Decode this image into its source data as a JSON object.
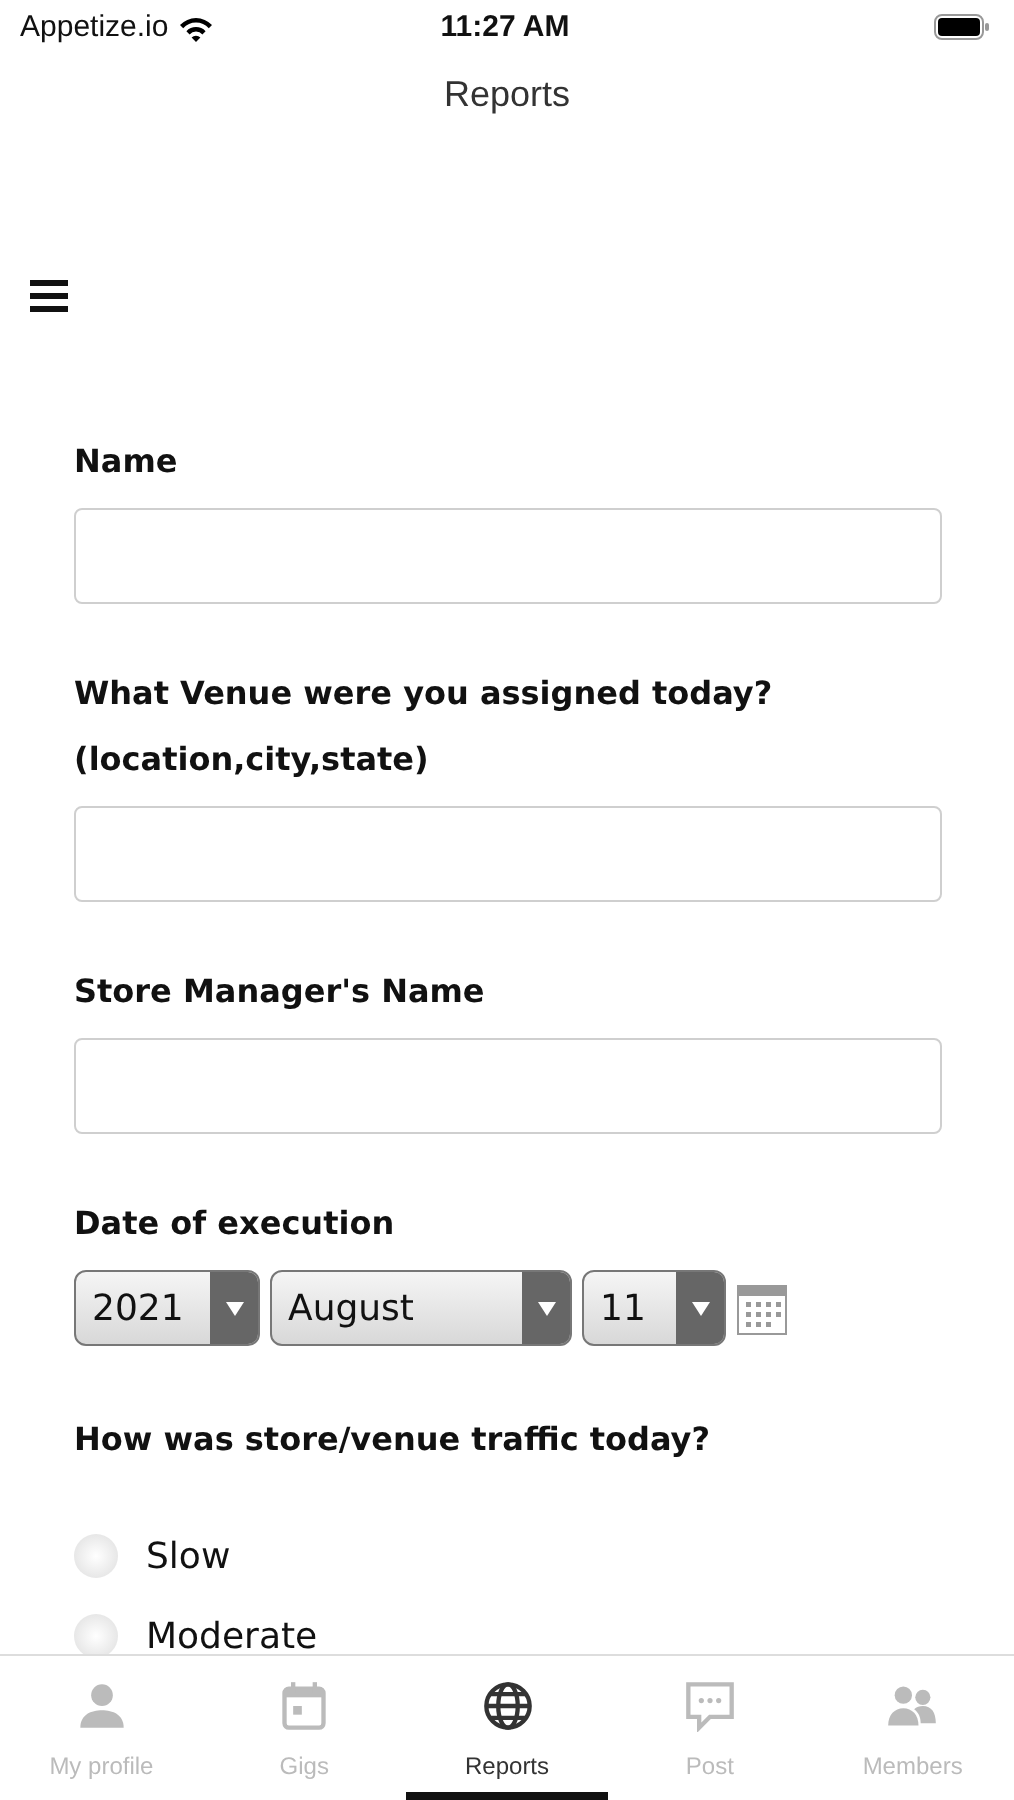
{
  "status_bar": {
    "carrier": "Appetize.io",
    "time": "11:27 AM"
  },
  "header": {
    "title": "Reports"
  },
  "form": {
    "fields": [
      {
        "label": "Name"
      },
      {
        "label": "What Venue were you assigned today? (location,city,state)"
      },
      {
        "label": "Store Manager's Name"
      }
    ],
    "date": {
      "label": "Date of execution",
      "year": "2021",
      "month": "August",
      "day": "11"
    },
    "traffic": {
      "label": "How was store/venue traffic today?",
      "options": [
        {
          "label": "Slow",
          "selected": false
        },
        {
          "label": "Moderate",
          "selected": false
        }
      ]
    }
  },
  "tab_bar": [
    {
      "label": "My profile",
      "selected": false
    },
    {
      "label": "Gigs",
      "selected": false
    },
    {
      "label": "Reports",
      "selected": true
    },
    {
      "label": "Post",
      "selected": false
    },
    {
      "label": "Members",
      "selected": false
    }
  ]
}
